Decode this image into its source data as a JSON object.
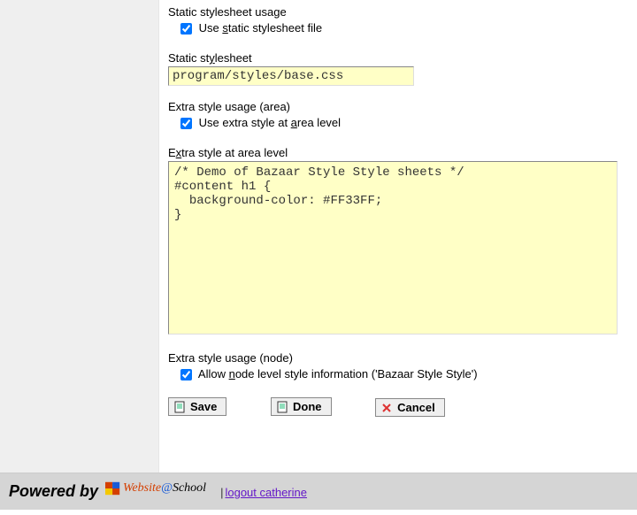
{
  "section1": {
    "title": "Static stylesheet usage",
    "checkbox_pre": "Use ",
    "checkbox_u": "s",
    "checkbox_post": "tatic stylesheet file",
    "checked": true
  },
  "section2": {
    "title_pre": "Static st",
    "title_u": "y",
    "title_post": "lesheet",
    "value": "program/styles/base.css"
  },
  "section3": {
    "title": "Extra style usage (area)",
    "checkbox_pre": "Use extra style at ",
    "checkbox_u": "a",
    "checkbox_post": "rea level",
    "checked": true
  },
  "section4": {
    "title_pre": "E",
    "title_u": "x",
    "title_post": "tra style at area level",
    "value": "/* Demo of Bazaar Style Style sheets */\n#content h1 {\n  background-color: #FF33FF;\n}"
  },
  "section5": {
    "title": "Extra style usage (node)",
    "checkbox_pre": "Allow ",
    "checkbox_u": "n",
    "checkbox_post": "ode level style information ('Bazaar Style Style')",
    "checked": true
  },
  "buttons": {
    "save": "Save",
    "done": "Done",
    "cancel": "Cancel"
  },
  "footer": {
    "powered": "Powered by",
    "logo_website": "Website",
    "logo_at": "@",
    "logo_school": "School",
    "logout": "logout catherine"
  }
}
